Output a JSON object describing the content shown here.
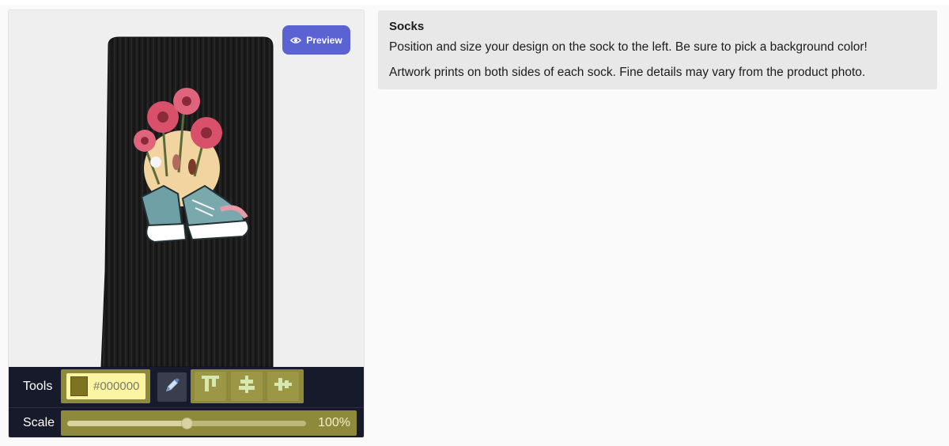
{
  "product": {
    "name": "Socks",
    "instructions": [
      "Position and size your design on the sock to the left. Be sure to pick a background color!",
      "Artwork prints on both sides of each sock. Fine details may vary from the product photo."
    ]
  },
  "preview_button": {
    "label": "Preview",
    "icon": "eye-icon"
  },
  "toolbar": {
    "tools_label": "Tools",
    "color": {
      "value": "#000000",
      "display_value": "#000000",
      "swatch_color": "#7d7320"
    },
    "eyedropper_icon": "eyedropper-icon",
    "align_buttons": [
      {
        "icon": "align-top-icon"
      },
      {
        "icon": "align-center-vertical-icon"
      },
      {
        "icon": "align-center-horizontal-icon"
      }
    ],
    "scale_label": "Scale",
    "scale": {
      "value_text": "100%",
      "level": 0.5
    }
  },
  "colors": {
    "preview_button": "#5b63d3",
    "toolbar_bg": "#171a2a",
    "tool_highlight": "#8e8a3b",
    "sock": "#1b1b1b"
  }
}
